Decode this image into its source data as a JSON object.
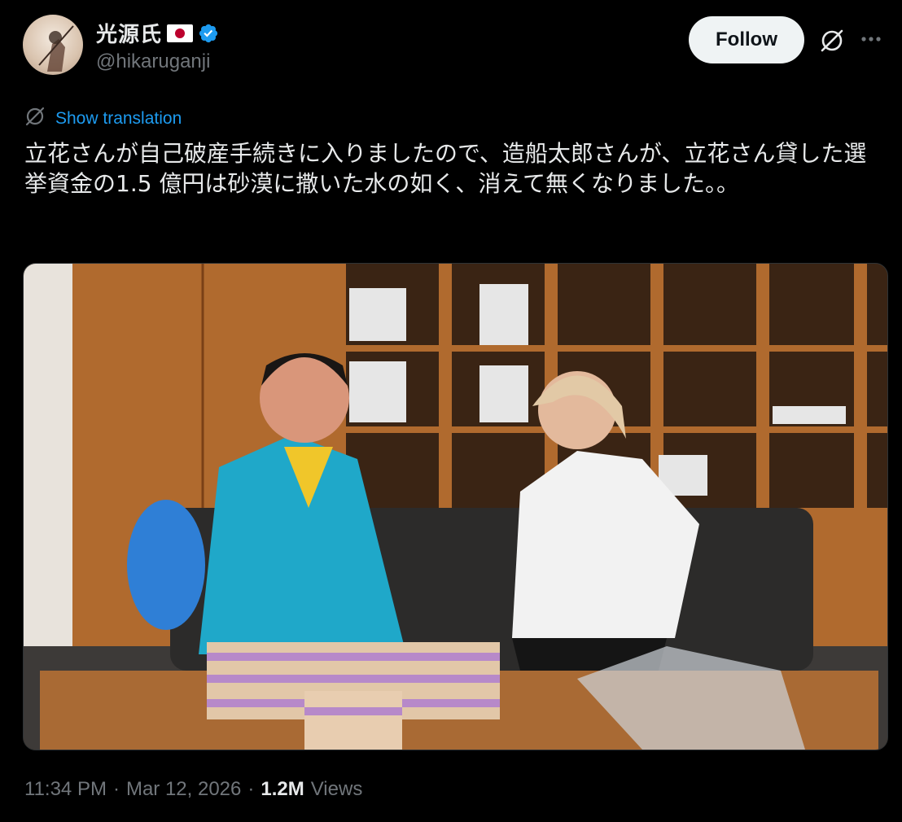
{
  "author": {
    "display_name": "光源氏",
    "handle": "@hikaruganji",
    "verified": true,
    "flag_emoji": "japan-flag-icon"
  },
  "header": {
    "follow_label": "Follow",
    "grok_icon": "grok-icon",
    "more_icon": "more-options-icon"
  },
  "translation": {
    "label": "Show translation"
  },
  "tweet": {
    "text": "立花さんが自己破産手続きに入りましたので、造船太郎さんが、立花さん貸した選挙資金の1.5 億円は砂漠に撒いた水の如く、消えて無くなりました。。"
  },
  "meta": {
    "time": "11:34 PM",
    "separator": "·",
    "date": "Mar 12, 2026",
    "views_count": "1.2M",
    "views_label": "Views"
  },
  "colors": {
    "background": "#000000",
    "text": "#e7e9ea",
    "muted": "#71767b",
    "link": "#1d9bf0",
    "verified": "#1d9bf0"
  }
}
